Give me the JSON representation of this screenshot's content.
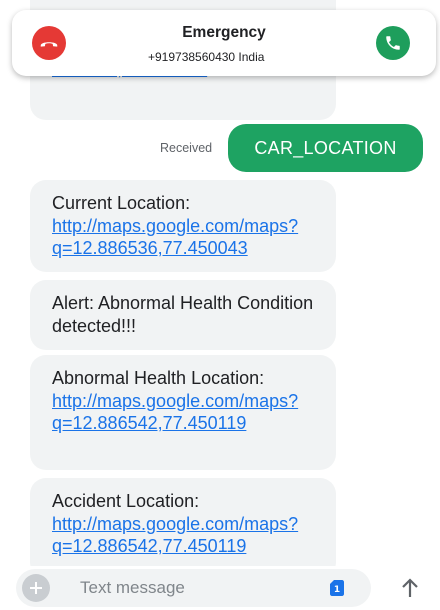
{
  "call": {
    "caller_name": "Emergency",
    "caller_number": "+919738560430  India"
  },
  "messages": [
    {
      "link": ".886536,77.450043"
    },
    {
      "prefix": "Current Location: ",
      "link": "http://maps.google.com/maps?q=12.886536,77.450043"
    },
    {
      "text": "Alert: Abnormal Health Condition detected!!!"
    },
    {
      "prefix": "Abnormal Health Location: ",
      "link": "http://maps.google.com/maps?q=12.886542,77.450119"
    },
    {
      "prefix": "Accident Location: ",
      "link": "http://maps.google.com/maps?q=12.886542,77.450119"
    }
  ],
  "sent": {
    "status": "Received",
    "text": "CAR_LOCATION"
  },
  "compose": {
    "placeholder": "Text message",
    "sim_slot": "1"
  },
  "colors": {
    "sent_bubble": "#1ea362",
    "link": "#1a73e8",
    "decline": "#e53935",
    "accept": "#1e9e5c"
  },
  "icons": {
    "decline": "phone-hangup-icon",
    "accept": "phone-icon",
    "attach": "plus-icon",
    "sim": "sim-card-icon",
    "send": "arrow-up-icon"
  }
}
